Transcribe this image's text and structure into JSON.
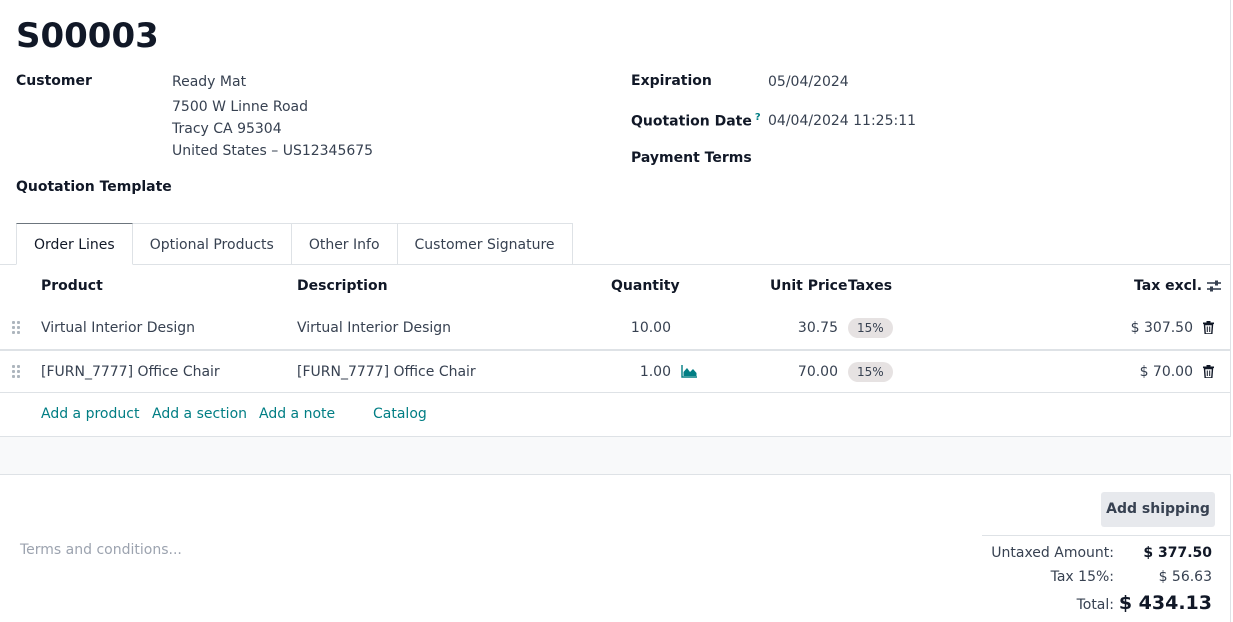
{
  "record": {
    "name": "S00003"
  },
  "customer": {
    "label": "Customer",
    "name": "Ready Mat",
    "address1": "7500 W Linne Road",
    "address2": "Tracy CA 95304",
    "address3": "United States – US12345675"
  },
  "quotation_template": {
    "label": "Quotation Template"
  },
  "expiration": {
    "label": "Expiration",
    "value": "05/04/2024"
  },
  "quotation_date": {
    "label": "Quotation Date",
    "help": "?",
    "value": "04/04/2024 11:25:11"
  },
  "payment_terms": {
    "label": "Payment Terms"
  },
  "tabs": [
    {
      "label": "Order Lines",
      "active": true
    },
    {
      "label": "Optional Products"
    },
    {
      "label": "Other Info"
    },
    {
      "label": "Customer Signature"
    }
  ],
  "table": {
    "headers": {
      "product": "Product",
      "description": "Description",
      "quantity": "Quantity",
      "unit_price": "Unit Price",
      "taxes": "Taxes",
      "tax_excl": "Tax excl."
    },
    "rows": [
      {
        "product": "Virtual Interior Design",
        "description": "Virtual Interior Design",
        "quantity": "10.00",
        "unit_price": "30.75",
        "tax": "15%",
        "subtotal": "$ 307.50"
      },
      {
        "product": "[FURN_7777] Office Chair",
        "description": "[FURN_7777] Office Chair",
        "quantity": "1.00",
        "unit_price": "70.00",
        "tax": "15%",
        "subtotal": "$ 70.00"
      }
    ],
    "actions": {
      "add_product": "Add a product",
      "add_section": "Add a section",
      "add_note": "Add a note",
      "catalog": "Catalog"
    }
  },
  "footer": {
    "add_shipping": "Add shipping",
    "terms_placeholder": "Terms and conditions...",
    "untaxed_label": "Untaxed Amount:",
    "untaxed_value": "$ 377.50",
    "tax_label": "Tax 15%:",
    "tax_value": "$ 56.63",
    "total_label": "Total:",
    "total_value": "$ 434.13"
  },
  "colors": {
    "accent": "#017e84",
    "badge": "#e6e2e2",
    "border": "#dee2e6"
  },
  "icons": [
    "drag-handle-icon",
    "forecast-chart-icon",
    "trash-icon",
    "optional-columns-icon"
  ]
}
